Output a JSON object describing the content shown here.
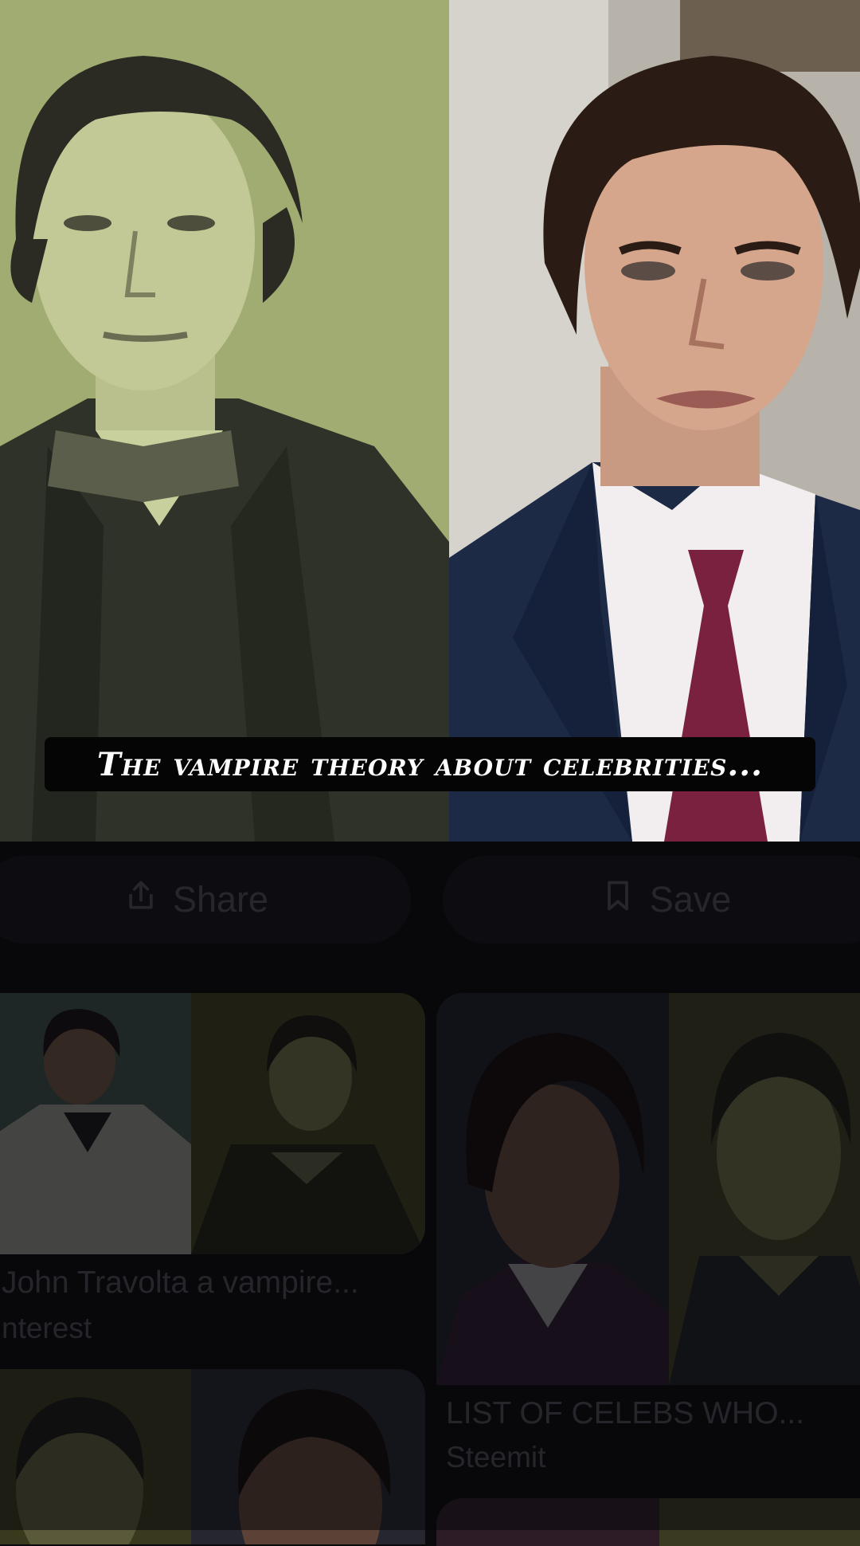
{
  "pin": {
    "caption": "The vampire theory about celebrities..."
  },
  "actions": {
    "share_label": "Share",
    "save_label": "Save"
  },
  "related": [
    {
      "title": "John Travolta a vampire...",
      "source": "nterest"
    },
    {
      "title": "LIST OF CELEBS WHO...",
      "source": "Steemit"
    }
  ],
  "icons": {
    "share": "share-icon",
    "save": "bookmark-icon"
  },
  "colors": {
    "background": "#0b0a0d",
    "button_bg": "#15141a",
    "muted_text": "#4a4a52"
  }
}
